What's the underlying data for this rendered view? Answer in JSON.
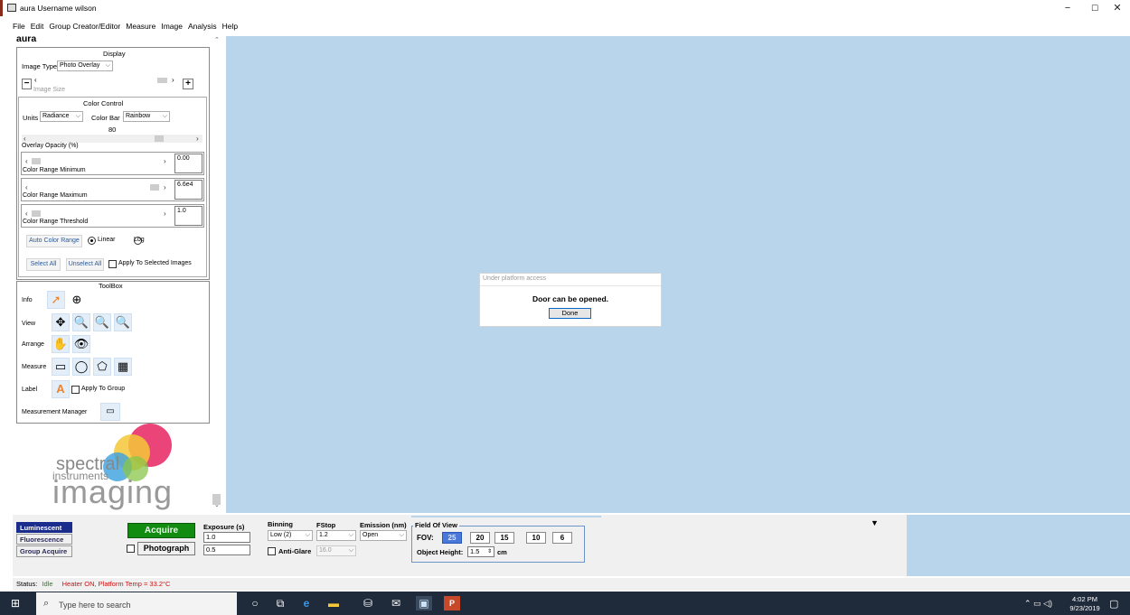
{
  "window": {
    "title": "aura  Username wilson",
    "controls": {
      "minimize": "−",
      "maximize": "☐",
      "close": "✕"
    }
  },
  "menu": [
    "File",
    "Edit",
    "Group Creator/Editor",
    "Measure",
    "Image",
    "Analysis",
    "Help"
  ],
  "app_heading": "aura",
  "display": {
    "section_title": "Display",
    "image_type_label": "Image Type",
    "image_type_value": "Photo Overlay",
    "image_size_label": "Image Size",
    "minus": "−",
    "plus": "+"
  },
  "color_control": {
    "section_title": "Color Control",
    "units_label": "Units",
    "units_value": "Radiance",
    "color_bar_label": "Color Bar",
    "color_bar_value": "Rainbow",
    "opacity_value": "80",
    "opacity_label": "Overlay Opacity (%)",
    "range_min_label": "Color Range Minimum",
    "range_min_value": "0.00",
    "range_max_label": "Color Range Maximum",
    "range_max_value": "6.6e4",
    "threshold_label": "Color Range Threshold",
    "threshold_value": "1.0",
    "auto_color_range": "Auto Color Range",
    "linear_label": "Linear",
    "log_label": "Log",
    "select_all": "Select All",
    "unselect_all": "Unselect All",
    "apply_selected_label": "Apply To Selected Images"
  },
  "toolbox": {
    "section_title": "ToolBox",
    "info_label": "Info",
    "view_label": "View",
    "arrange_label": "Arrange",
    "measure_label": "Measure",
    "label_label": "Label",
    "apply_group_label": "Apply To Group",
    "measurement_manager_label": "Measurement Manager"
  },
  "logo": {
    "line1": "spectral",
    "line2": "instruments",
    "line3": "imaging"
  },
  "dialog": {
    "title": "Under platform access",
    "message": "Door can be opened.",
    "done_label": "Done"
  },
  "controls": {
    "modes": [
      "Luminescent",
      "Fluorescence",
      "Group Acquire"
    ],
    "acquire_label": "Acquire",
    "photograph_label": "Photograph",
    "exposure_label": "Exposure (s)",
    "exposure_value": "1.0",
    "photo_exposure_value": "0.5",
    "binning_label": "Binning",
    "binning_value": "Low   (2)",
    "fstop_label": "FStop",
    "fstop_value": "1.2",
    "emission_label": "Emission (nm)",
    "emission_value": "Open",
    "anti_glare_label": "Anti-Glare",
    "anti_glare_value": "16.0",
    "fov_group_label": "Field Of View",
    "fov_label": "FOV:",
    "fov_options": [
      "25",
      "20",
      "15",
      "10",
      "6"
    ],
    "object_height_label": "Object Height:",
    "object_height_value": "1.5",
    "object_height_unit": "cm"
  },
  "status": {
    "status_label": "Status:",
    "status_value": "Idle",
    "heater_text": "Heater ON, Platform Temp = 33.2°C"
  },
  "taskbar": {
    "search_placeholder": "Type here to search",
    "time": "4:02 PM",
    "date": "9/23/2019"
  },
  "colors": {
    "canvas": "#b8d5eb",
    "acquire_green": "#118c11",
    "luminescent_blue": "#1a2c8c",
    "status_green": "#1a8a1a",
    "status_red": "#cc1111",
    "taskbar": "#1f2a3a"
  }
}
